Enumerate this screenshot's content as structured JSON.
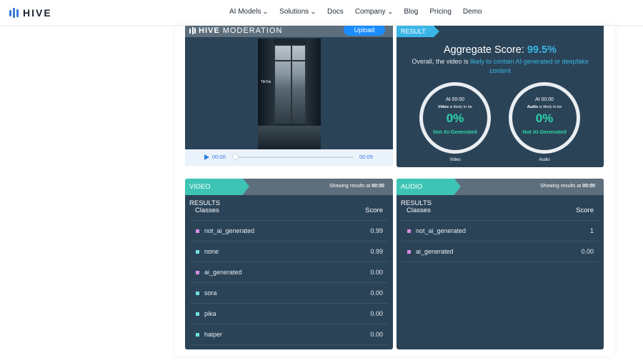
{
  "brand": {
    "name": "HIVE"
  },
  "nav": {
    "items": [
      {
        "label": "AI Models",
        "has_dropdown": true
      },
      {
        "label": "Solutions",
        "has_dropdown": true
      },
      {
        "label": "Docs",
        "has_dropdown": false
      },
      {
        "label": "Company",
        "has_dropdown": true
      },
      {
        "label": "Blog",
        "has_dropdown": false
      },
      {
        "label": "Pricing",
        "has_dropdown": false
      },
      {
        "label": "Demo",
        "has_dropdown": false
      }
    ]
  },
  "moderation": {
    "logo_bold": "HIVE",
    "logo_light": "MODERATION",
    "upload_label": "Upload",
    "video_watermark": "TikTok",
    "player": {
      "current_time": "00:00",
      "duration": "00:09",
      "progress": 0
    }
  },
  "result": {
    "tag": "RESULT",
    "aggregate_label": "Aggregate Score:",
    "aggregate_value": "99.5%",
    "overall_prefix": "Overall, the video is",
    "overall_highlight": "likely to contain AI-generated or deepfake content",
    "video_ring": {
      "at": "At 00:00",
      "subject": "Video",
      "likely_text": "is likely to be",
      "percent": "0%",
      "status": "Not AI-Generated",
      "caption": "Video"
    },
    "audio_ring": {
      "at": "At 00:00",
      "subject": "Audio",
      "likely_text": "is likely to be",
      "percent": "0%",
      "status": "Not AI-Generated",
      "caption": "Audio"
    }
  },
  "video_results": {
    "tag": "VIDEO RESULTS",
    "showing_prefix": "Showing results at",
    "showing_time": "00:00",
    "col_classes": "Classes",
    "col_score": "Score",
    "rows": [
      {
        "label": "not_ai_generated",
        "score": "0.99",
        "color": "#d88ee8"
      },
      {
        "label": "none",
        "score": "0.99",
        "color": "#6fe0e0"
      },
      {
        "label": "ai_generated",
        "score": "0.00",
        "color": "#d88ee8"
      },
      {
        "label": "sora",
        "score": "0.00",
        "color": "#6fe0e0"
      },
      {
        "label": "pika",
        "score": "0.00",
        "color": "#6fe0e0"
      },
      {
        "label": "haiper",
        "score": "0.00",
        "color": "#6fe0e0"
      }
    ]
  },
  "audio_results": {
    "tag": "AUDIO RESULTS",
    "showing_prefix": "Showing results at",
    "showing_time": "00:00",
    "col_classes": "Classes",
    "col_score": "Score",
    "rows": [
      {
        "label": "not_ai_generated",
        "score": "1",
        "color": "#d88ee8"
      },
      {
        "label": "ai_generated",
        "score": "0.00",
        "color": "#d88ee8"
      }
    ]
  },
  "colors": {
    "accent_blue": "#3ab5e6",
    "accent_teal": "#3ec4b5",
    "positive_green": "#2dd4a9",
    "panel_bg": "#2b4357"
  }
}
